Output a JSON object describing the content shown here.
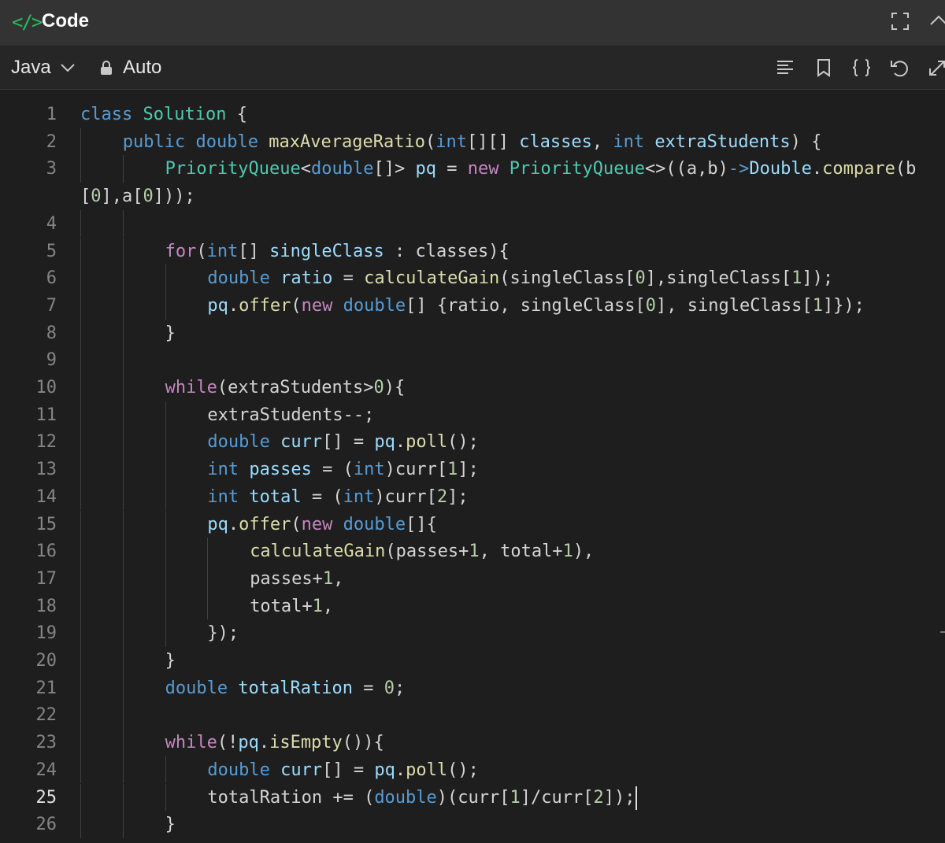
{
  "panel": {
    "icon_text": "</>",
    "title": "Code"
  },
  "toolbar": {
    "language": "Java",
    "mode": "Auto"
  },
  "colors": {
    "accent_green": "#2cbb5d",
    "keyword": "#569cd6",
    "type": "#4ec9b0",
    "control": "#c586c0",
    "function": "#dcdcaa",
    "variable": "#9cdcfe",
    "number": "#b5cea8"
  },
  "editor": {
    "active_line": 25,
    "lines": [
      {
        "n": "1",
        "indent": 0,
        "tokens": [
          [
            "kw",
            "class"
          ],
          [
            "pl",
            " "
          ],
          [
            "ty",
            "Solution"
          ],
          [
            "pl",
            " {"
          ]
        ]
      },
      {
        "n": "2",
        "indent": 1,
        "tokens": [
          [
            "kw",
            "public"
          ],
          [
            "pl",
            " "
          ],
          [
            "kw",
            "double"
          ],
          [
            "pl",
            " "
          ],
          [
            "fn",
            "maxAverageRatio"
          ],
          [
            "pl",
            "("
          ],
          [
            "kw",
            "int"
          ],
          [
            "pl",
            "[][] "
          ],
          [
            "var",
            "classes"
          ],
          [
            "pl",
            ", "
          ],
          [
            "kw",
            "int"
          ],
          [
            "pl",
            " "
          ],
          [
            "var",
            "extraStudents"
          ],
          [
            "pl",
            ") {"
          ]
        ]
      },
      {
        "n": "3",
        "indent": 2,
        "tokens": [
          [
            "ty",
            "PriorityQueue"
          ],
          [
            "pl",
            "<"
          ],
          [
            "kw",
            "double"
          ],
          [
            "pl",
            "[]> "
          ],
          [
            "var",
            "pq"
          ],
          [
            "pl",
            " = "
          ],
          [
            "ctl",
            "new"
          ],
          [
            "pl",
            " "
          ],
          [
            "ty",
            "PriorityQueue"
          ],
          [
            "pl",
            "<>((a,b)"
          ],
          [
            "kw",
            "->"
          ],
          [
            "var",
            "Double"
          ],
          [
            "pl",
            "."
          ],
          [
            "fn",
            "compare"
          ],
          [
            "pl",
            "(b"
          ]
        ]
      },
      {
        "n": "",
        "indent": 0,
        "wrap": true,
        "tokens": [
          [
            "pl",
            "["
          ],
          [
            "num",
            "0"
          ],
          [
            "pl",
            "],a["
          ],
          [
            "num",
            "0"
          ],
          [
            "pl",
            "]));"
          ]
        ]
      },
      {
        "n": "4",
        "indent": 2,
        "tokens": []
      },
      {
        "n": "5",
        "indent": 2,
        "tokens": [
          [
            "ctl",
            "for"
          ],
          [
            "pl",
            "("
          ],
          [
            "kw",
            "int"
          ],
          [
            "pl",
            "[] "
          ],
          [
            "var",
            "singleClass"
          ],
          [
            "pl",
            " : classes){"
          ]
        ]
      },
      {
        "n": "6",
        "indent": 3,
        "tokens": [
          [
            "kw",
            "double"
          ],
          [
            "pl",
            " "
          ],
          [
            "var",
            "ratio"
          ],
          [
            "pl",
            " = "
          ],
          [
            "fn",
            "calculateGain"
          ],
          [
            "pl",
            "(singleClass["
          ],
          [
            "num",
            "0"
          ],
          [
            "pl",
            "],singleClass["
          ],
          [
            "num",
            "1"
          ],
          [
            "pl",
            "]);"
          ]
        ]
      },
      {
        "n": "7",
        "indent": 3,
        "tokens": [
          [
            "var",
            "pq"
          ],
          [
            "pl",
            "."
          ],
          [
            "fn",
            "offer"
          ],
          [
            "pl",
            "("
          ],
          [
            "ctl",
            "new"
          ],
          [
            "pl",
            " "
          ],
          [
            "kw",
            "double"
          ],
          [
            "pl",
            "[] {ratio, singleClass["
          ],
          [
            "num",
            "0"
          ],
          [
            "pl",
            "], singleClass["
          ],
          [
            "num",
            "1"
          ],
          [
            "pl",
            "]});"
          ]
        ]
      },
      {
        "n": "8",
        "indent": 2,
        "tokens": [
          [
            "pl",
            "}"
          ]
        ]
      },
      {
        "n": "9",
        "indent": 2,
        "tokens": []
      },
      {
        "n": "10",
        "indent": 2,
        "tokens": [
          [
            "ctl",
            "while"
          ],
          [
            "pl",
            "(extraStudents>"
          ],
          [
            "num",
            "0"
          ],
          [
            "pl",
            "){"
          ]
        ]
      },
      {
        "n": "11",
        "indent": 3,
        "tokens": [
          [
            "pl",
            "extraStudents--;"
          ]
        ]
      },
      {
        "n": "12",
        "indent": 3,
        "tokens": [
          [
            "kw",
            "double"
          ],
          [
            "pl",
            " "
          ],
          [
            "var",
            "curr"
          ],
          [
            "pl",
            "[] = "
          ],
          [
            "var",
            "pq"
          ],
          [
            "pl",
            "."
          ],
          [
            "fn",
            "poll"
          ],
          [
            "pl",
            "();"
          ]
        ]
      },
      {
        "n": "13",
        "indent": 3,
        "tokens": [
          [
            "kw",
            "int"
          ],
          [
            "pl",
            " "
          ],
          [
            "var",
            "passes"
          ],
          [
            "pl",
            " = ("
          ],
          [
            "kw",
            "int"
          ],
          [
            "pl",
            ")curr["
          ],
          [
            "num",
            "1"
          ],
          [
            "pl",
            "];"
          ]
        ]
      },
      {
        "n": "14",
        "indent": 3,
        "tokens": [
          [
            "kw",
            "int"
          ],
          [
            "pl",
            " "
          ],
          [
            "var",
            "total"
          ],
          [
            "pl",
            " = ("
          ],
          [
            "kw",
            "int"
          ],
          [
            "pl",
            ")curr["
          ],
          [
            "num",
            "2"
          ],
          [
            "pl",
            "];"
          ]
        ]
      },
      {
        "n": "15",
        "indent": 3,
        "tokens": [
          [
            "var",
            "pq"
          ],
          [
            "pl",
            "."
          ],
          [
            "fn",
            "offer"
          ],
          [
            "pl",
            "("
          ],
          [
            "ctl",
            "new"
          ],
          [
            "pl",
            " "
          ],
          [
            "kw",
            "double"
          ],
          [
            "pl",
            "[]{"
          ]
        ]
      },
      {
        "n": "16",
        "indent": 4,
        "tokens": [
          [
            "fn",
            "calculateGain"
          ],
          [
            "pl",
            "(passes+"
          ],
          [
            "num",
            "1"
          ],
          [
            "pl",
            ", total+"
          ],
          [
            "num",
            "1"
          ],
          [
            "pl",
            "),"
          ]
        ]
      },
      {
        "n": "17",
        "indent": 4,
        "tokens": [
          [
            "pl",
            "passes+"
          ],
          [
            "num",
            "1"
          ],
          [
            "pl",
            ","
          ]
        ]
      },
      {
        "n": "18",
        "indent": 4,
        "tokens": [
          [
            "pl",
            "total+"
          ],
          [
            "num",
            "1"
          ],
          [
            "pl",
            ","
          ]
        ]
      },
      {
        "n": "19",
        "indent": 3,
        "tokens": [
          [
            "pl",
            "});"
          ]
        ]
      },
      {
        "n": "20",
        "indent": 2,
        "tokens": [
          [
            "pl",
            "}"
          ]
        ]
      },
      {
        "n": "21",
        "indent": 2,
        "tokens": [
          [
            "kw",
            "double"
          ],
          [
            "pl",
            " "
          ],
          [
            "var",
            "totalRation"
          ],
          [
            "pl",
            " = "
          ],
          [
            "num",
            "0"
          ],
          [
            "pl",
            ";"
          ]
        ]
      },
      {
        "n": "22",
        "indent": 2,
        "tokens": []
      },
      {
        "n": "23",
        "indent": 2,
        "tokens": [
          [
            "ctl",
            "while"
          ],
          [
            "pl",
            "(!"
          ],
          [
            "var",
            "pq"
          ],
          [
            "pl",
            "."
          ],
          [
            "fn",
            "isEmpty"
          ],
          [
            "pl",
            "()){"
          ]
        ]
      },
      {
        "n": "24",
        "indent": 3,
        "tokens": [
          [
            "kw",
            "double"
          ],
          [
            "pl",
            " "
          ],
          [
            "var",
            "curr"
          ],
          [
            "pl",
            "[] = "
          ],
          [
            "var",
            "pq"
          ],
          [
            "pl",
            "."
          ],
          [
            "fn",
            "poll"
          ],
          [
            "pl",
            "();"
          ]
        ]
      },
      {
        "n": "25",
        "indent": 3,
        "cursor": true,
        "tokens": [
          [
            "pl",
            "totalRation += ("
          ],
          [
            "kw",
            "double"
          ],
          [
            "pl",
            ")(curr["
          ],
          [
            "num",
            "1"
          ],
          [
            "pl",
            "]/curr["
          ],
          [
            "num",
            "2"
          ],
          [
            "pl",
            "]);"
          ]
        ]
      },
      {
        "n": "26",
        "indent": 2,
        "tokens": [
          [
            "pl",
            "}"
          ]
        ]
      }
    ]
  }
}
